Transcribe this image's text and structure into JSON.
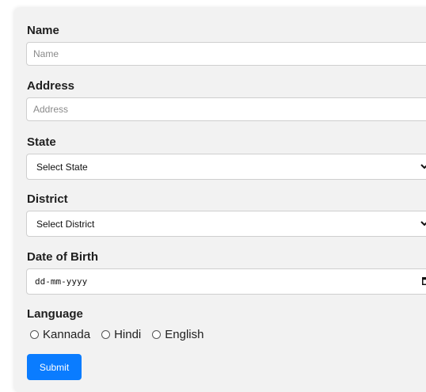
{
  "form": {
    "name": {
      "label": "Name",
      "placeholder": "Name",
      "value": ""
    },
    "address": {
      "label": "Address",
      "placeholder": "Address",
      "value": ""
    },
    "state": {
      "label": "State",
      "selected": "Select State"
    },
    "district": {
      "label": "District",
      "selected": "Select District"
    },
    "dob": {
      "label": "Date of Birth",
      "placeholder": "dd-mm-yyyy"
    },
    "language": {
      "label": "Language",
      "options": [
        "Kannada",
        "Hindi",
        "English"
      ]
    },
    "submit_label": "Submit"
  },
  "colors": {
    "card_background": "#f2f2f2",
    "submit_background": "#0a7cff",
    "input_border": "#cfcfcf"
  }
}
